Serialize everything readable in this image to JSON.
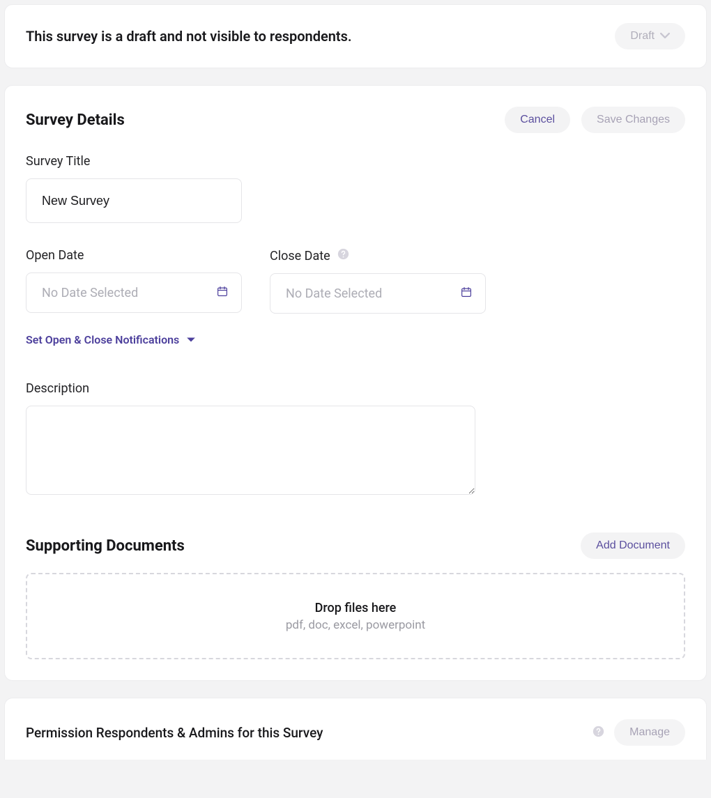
{
  "banner": {
    "message": "This survey is a draft and not visible to respondents.",
    "status": "Draft"
  },
  "details": {
    "heading": "Survey Details",
    "cancel_label": "Cancel",
    "save_label": "Save Changes",
    "fields": {
      "title_label": "Survey Title",
      "title_value": "New Survey",
      "open_date_label": "Open Date",
      "open_date_placeholder": "No Date Selected",
      "close_date_label": "Close Date",
      "close_date_placeholder": "No Date Selected",
      "notifications_link": "Set Open & Close Notifications",
      "description_label": "Description",
      "description_value": ""
    }
  },
  "documents": {
    "heading": "Supporting Documents",
    "add_label": "Add Document",
    "drop_title": "Drop files here",
    "drop_sub": "pdf, doc, excel, powerpoint"
  },
  "permissions": {
    "heading": "Permission Respondents & Admins for this Survey",
    "manage_label": "Manage"
  }
}
